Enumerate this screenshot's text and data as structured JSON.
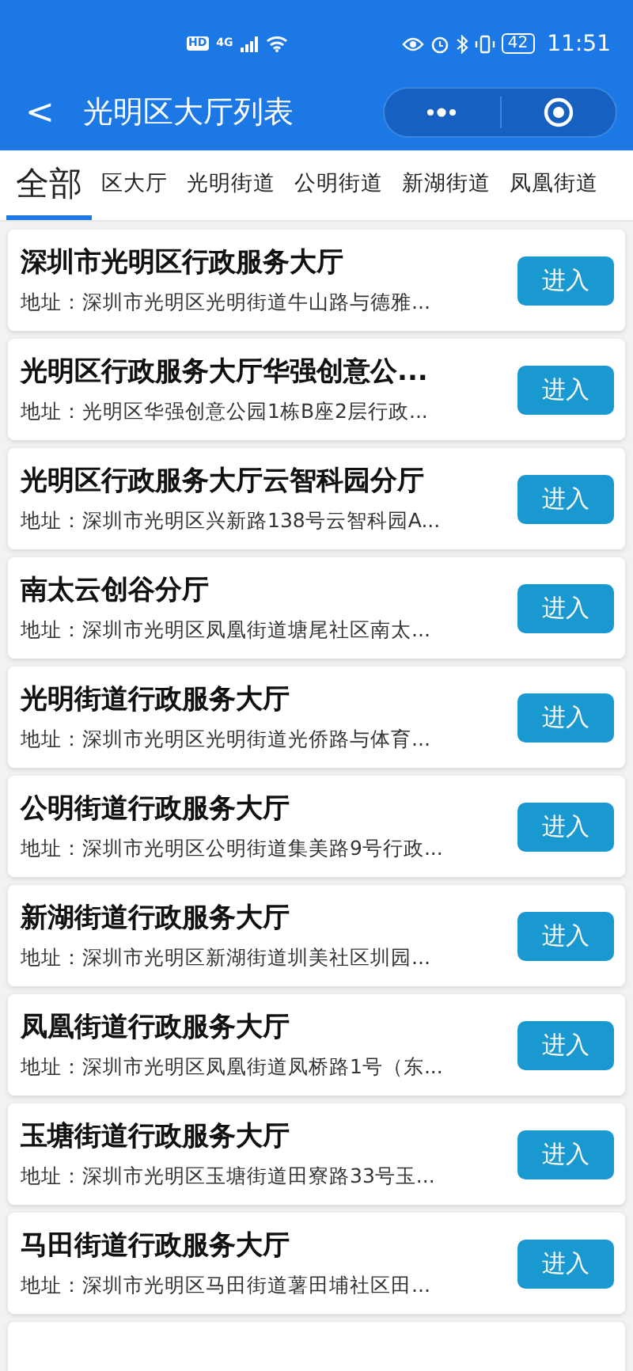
{
  "status_bar": {
    "badges": [
      "HD",
      "4G"
    ],
    "battery": "42",
    "time": "11:51"
  },
  "header": {
    "back": "<",
    "title": "光明区大厅列表"
  },
  "tabs": [
    {
      "label": "全部",
      "selected": true
    },
    {
      "label": "区大厅",
      "selected": false
    },
    {
      "label": "光明街道",
      "selected": false
    },
    {
      "label": "公明街道",
      "selected": false
    },
    {
      "label": "新湖街道",
      "selected": false
    },
    {
      "label": "凤凰街道",
      "selected": false
    }
  ],
  "halls": [
    {
      "name": "深圳市光明区行政服务大厅",
      "address": "地址：深圳市光明区光明街道牛山路与德雅...",
      "button": "进入"
    },
    {
      "name": "光明区行政服务大厅华强创意公...",
      "address": "地址：光明区华强创意公园1栋B座2层行政...",
      "button": "进入"
    },
    {
      "name": "光明区行政服务大厅云智科园分厅",
      "address": "地址：深圳市光明区兴新路138号云智科园A...",
      "button": "进入"
    },
    {
      "name": "南太云创谷分厅",
      "address": "地址：深圳市光明区凤凰街道塘尾社区南太...",
      "button": "进入"
    },
    {
      "name": "光明街道行政服务大厅",
      "address": "地址：深圳市光明区光明街道光侨路与体育...",
      "button": "进入"
    },
    {
      "name": "公明街道行政服务大厅",
      "address": "地址：深圳市光明区公明街道集美路9号行政...",
      "button": "进入"
    },
    {
      "name": "新湖街道行政服务大厅",
      "address": "地址：深圳市光明区新湖街道圳美社区圳园...",
      "button": "进入"
    },
    {
      "name": "凤凰街道行政服务大厅",
      "address": "地址：深圳市光明区凤凰街道凤桥路1号（东...",
      "button": "进入"
    },
    {
      "name": "玉塘街道行政服务大厅",
      "address": "地址：深圳市光明区玉塘街道田寮路33号玉...",
      "button": "进入"
    },
    {
      "name": "马田街道行政服务大厅",
      "address": "地址：深圳市光明区马田街道薯田埔社区田...",
      "button": "进入"
    }
  ]
}
